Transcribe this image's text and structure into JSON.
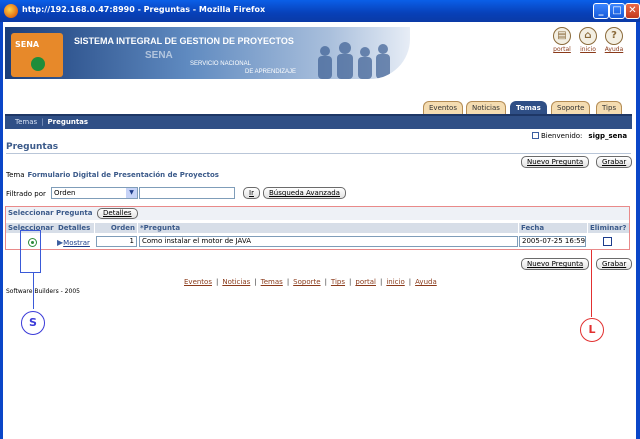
{
  "window": {
    "title": "http://192.168.0.47:8990 - Preguntas - Mozilla Firefox",
    "min_glyph": "_",
    "max_glyph": "□",
    "close_glyph": "✕"
  },
  "banner": {
    "logo_text": "SENA",
    "system_title": "SISTEMA INTEGRAL DE GESTION DE PROYECTOS",
    "sub1": "SENA",
    "sub2": "SERVICIO NACIONAL",
    "sub3": "DE APRENDIZAJE"
  },
  "top_icons": [
    {
      "label": "portal",
      "glyph": "▤"
    },
    {
      "label": "inicio",
      "glyph": "⌂"
    },
    {
      "label": "Ayuda",
      "glyph": "?"
    }
  ],
  "tabs": [
    {
      "label": "Eventos",
      "active": false
    },
    {
      "label": "Noticias",
      "active": false
    },
    {
      "label": "Temas",
      "active": true
    },
    {
      "label": "Soporte",
      "active": false
    },
    {
      "label": "Tips",
      "active": false
    }
  ],
  "breadcrumb": {
    "parent": "Temas",
    "separator": "|",
    "current": "Preguntas"
  },
  "welcome": {
    "label": "Bienvenido:",
    "user": "sigp_sena"
  },
  "page_title": "Preguntas",
  "buttons": {
    "new_question": "Nuevo Pregunta",
    "save": "Grabar",
    "go": "Ir",
    "advanced_search": "Búsqueda Avanzada",
    "details": "Detalles"
  },
  "tema": {
    "label": "Tema",
    "value": "Formulario Digital de Presentación de Proyectos"
  },
  "filter": {
    "label": "Filtrado por",
    "selected": "Orden",
    "value": ""
  },
  "table": {
    "section_label": "Seleccionar Pregunta",
    "columns": [
      "Seleccionar",
      "Detalles",
      "Orden",
      "*Pregunta",
      "Fecha",
      "Eliminar?"
    ],
    "rows": [
      {
        "selected": true,
        "detail_link": "Mostrar",
        "orden": "1",
        "pregunta": "Como instalar el motor de JAVA",
        "fecha": "2005-07-25 16:59:",
        "eliminar": false
      }
    ]
  },
  "footer": {
    "links": [
      "Eventos",
      "Noticias",
      "Temas",
      "Soporte",
      "Tips",
      "portal",
      "inicio",
      "Ayuda"
    ],
    "separator": "|",
    "credits": "Software Builders - 2005"
  },
  "annotations": {
    "s_label": "S",
    "l_label": "L"
  },
  "colors": {
    "nav_blue": "#2f4f86",
    "tab_bg": "#f4dcb1",
    "annotation_blue": "#3a5ad8",
    "annotation_red": "#e23030"
  }
}
